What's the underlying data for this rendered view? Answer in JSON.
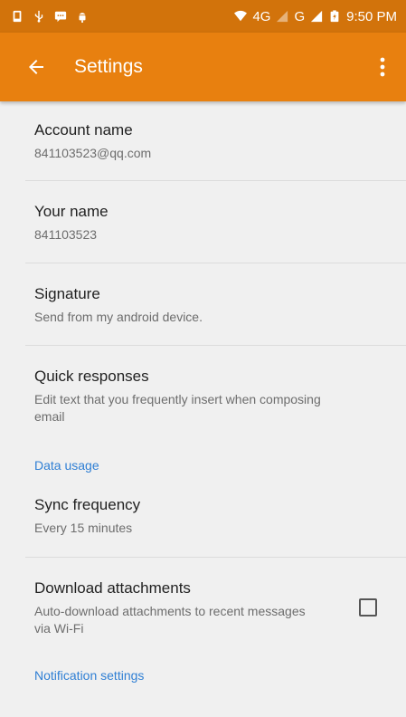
{
  "status_bar": {
    "network_label": "4G",
    "network2_label": "G",
    "time": "9:50 PM"
  },
  "app_bar": {
    "title": "Settings",
    "background_color": "#e8800f",
    "back_icon": "arrow-back-icon",
    "menu_icon": "more-vert-icon"
  },
  "settings": {
    "account_name": {
      "title": "Account name",
      "value": "841103523@qq.com"
    },
    "your_name": {
      "title": "Your name",
      "value": "841103523"
    },
    "signature": {
      "title": "Signature",
      "value": "Send from my android device."
    },
    "quick_responses": {
      "title": "Quick responses",
      "value": "Edit text that you frequently insert when composing email"
    },
    "data_usage_header": "Data usage",
    "sync_frequency": {
      "title": "Sync frequency",
      "value": "Every 15 minutes"
    },
    "download_attachments": {
      "title": "Download attachments",
      "value": "Auto-download attachments to recent messages via Wi-Fi",
      "checked": false
    },
    "notification_header": "Notification settings"
  },
  "colors": {
    "section_header": "#2f7fd4",
    "status_bar": "#d2730b"
  }
}
